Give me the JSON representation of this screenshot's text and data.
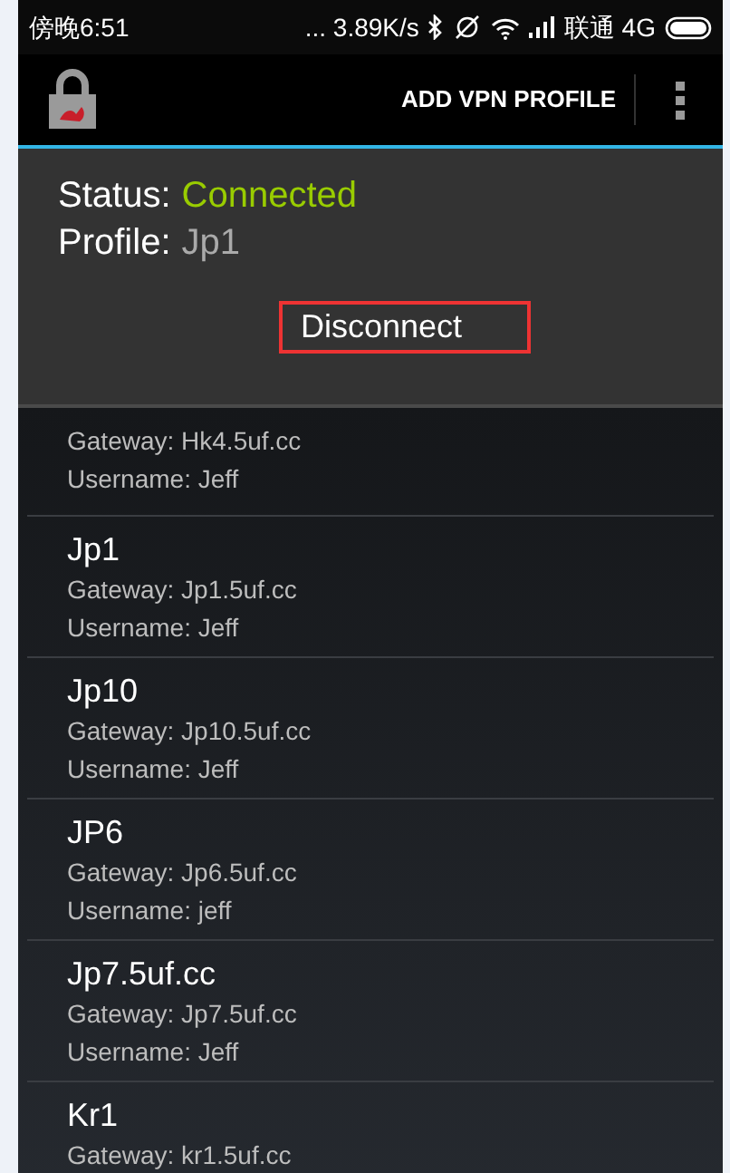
{
  "status_bar": {
    "time": "傍晚6:51",
    "speed": "... 3.89K/s",
    "carrier": "联通 4G"
  },
  "action_bar": {
    "action": "ADD VPN PROFILE"
  },
  "status_panel": {
    "status_label": "Status:",
    "status_value": "Connected",
    "profile_label": "Profile:",
    "profile_value": "Jp1",
    "button": "Disconnect"
  },
  "profiles": [
    {
      "gateway": "Gateway: Hk4.5uf.cc",
      "username": "Username: Jeff"
    },
    {
      "name": "Jp1",
      "gateway": "Gateway: Jp1.5uf.cc",
      "username": "Username: Jeff"
    },
    {
      "name": "Jp10",
      "gateway": "Gateway: Jp10.5uf.cc",
      "username": "Username: Jeff"
    },
    {
      "name": "JP6",
      "gateway": "Gateway: Jp6.5uf.cc",
      "username": "Username: jeff"
    },
    {
      "name": "Jp7.5uf.cc",
      "gateway": "Gateway: Jp7.5uf.cc",
      "username": "Username: Jeff"
    },
    {
      "name": "Kr1",
      "gateway": "Gateway: kr1.5uf.cc"
    }
  ]
}
